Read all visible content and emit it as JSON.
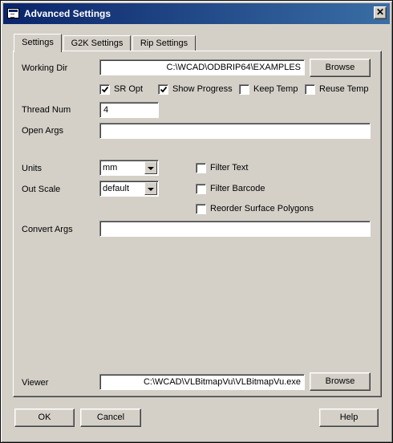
{
  "window": {
    "title": "Advanced Settings",
    "close_glyph": "✕"
  },
  "tabs": [
    {
      "label": "Settings",
      "active": true
    },
    {
      "label": "G2K Settings",
      "active": false
    },
    {
      "label": "Rip Settings",
      "active": false
    }
  ],
  "settings": {
    "working_dir": {
      "label": "Working Dir",
      "value": "C:\\WCAD\\ODBRIP64\\EXAMPLES",
      "browse_label": "Browse"
    },
    "options": [
      {
        "label": "SR Opt",
        "checked": true
      },
      {
        "label": "Show Progress",
        "checked": true
      },
      {
        "label": "Keep Temp",
        "checked": false
      },
      {
        "label": "Reuse Temp",
        "checked": false
      }
    ],
    "thread_num": {
      "label": "Thread Num",
      "value": "4"
    },
    "open_args": {
      "label": "Open Args",
      "value": ""
    },
    "units": {
      "label": "Units",
      "value": "mm"
    },
    "out_scale": {
      "label": "Out Scale",
      "value": "default"
    },
    "filters": [
      {
        "label": "Filter Text",
        "checked": false
      },
      {
        "label": "Filter Barcode",
        "checked": false
      },
      {
        "label": "Reorder Surface Polygons",
        "checked": false
      }
    ],
    "convert_args": {
      "label": "Convert Args",
      "value": ""
    },
    "viewer": {
      "label": "Viewer",
      "value": "C:\\WCAD\\VLBitmapVu\\VLBitmapVu.exe",
      "browse_label": "Browse"
    }
  },
  "footer": {
    "ok_label": "OK",
    "cancel_label": "Cancel",
    "help_label": "Help"
  },
  "colors": {
    "titlebar_start": "#0a246a",
    "titlebar_end": "#3a6ea5",
    "face": "#d4d0c8"
  }
}
